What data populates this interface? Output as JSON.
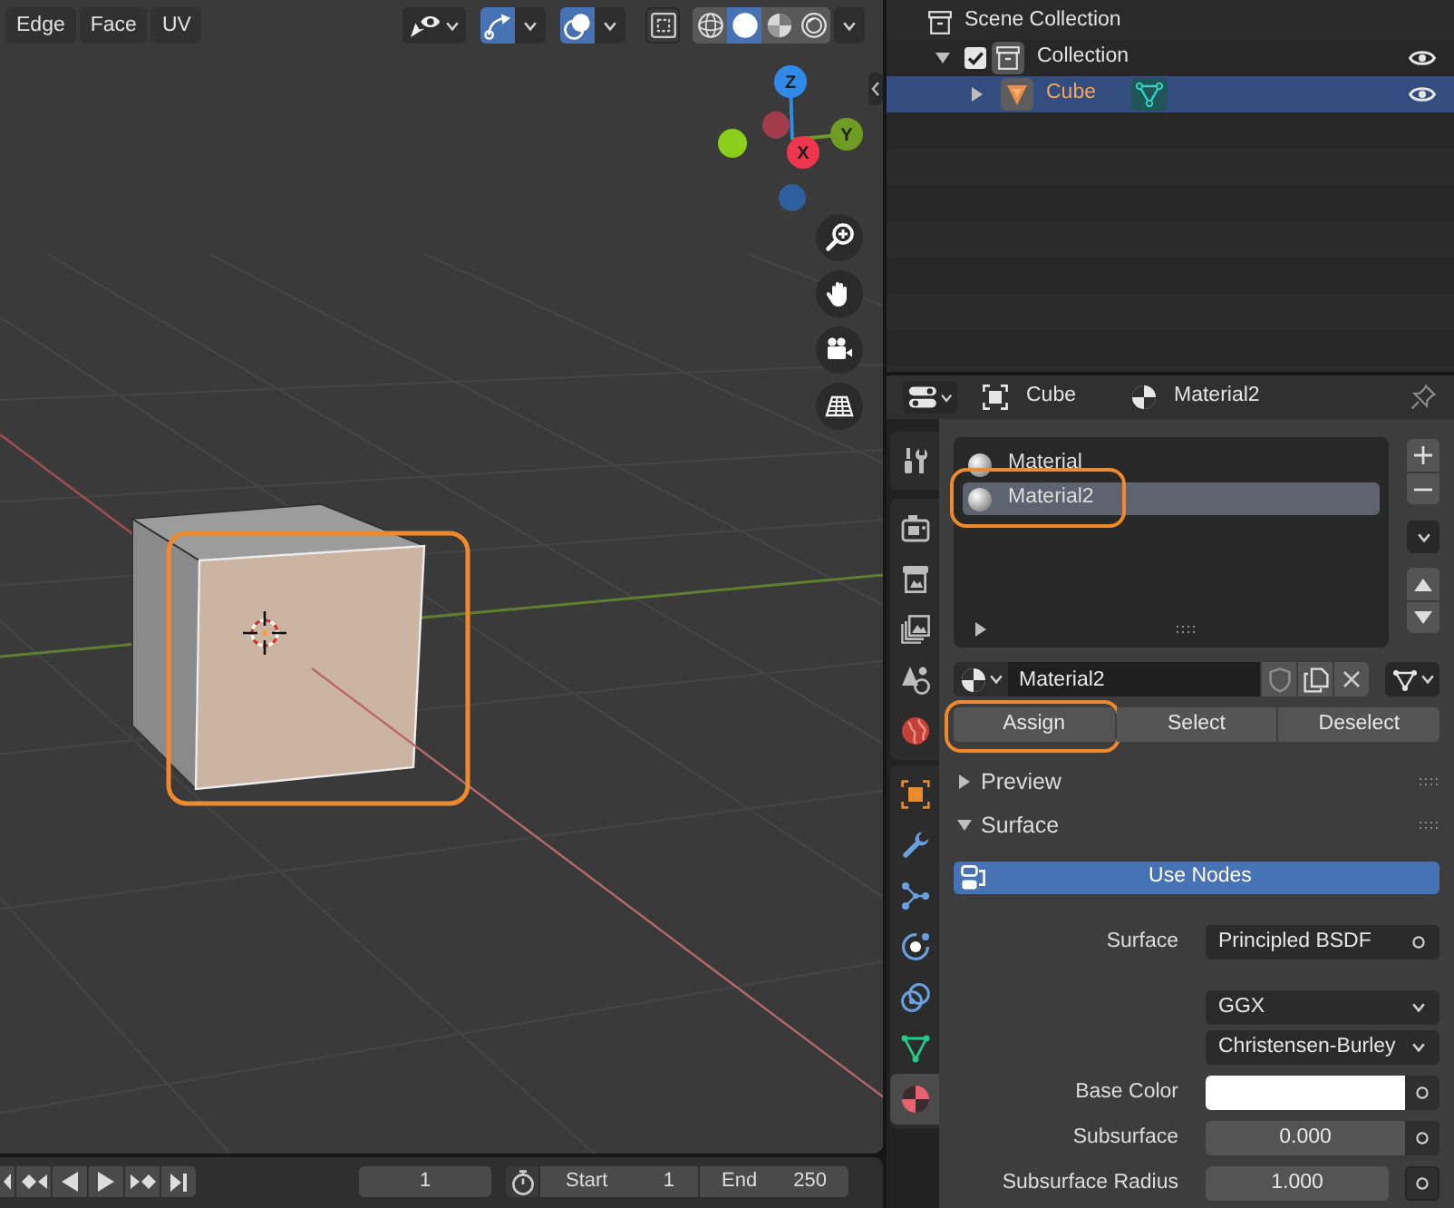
{
  "viewport": {
    "menus": [
      {
        "label": "Edge"
      },
      {
        "label": "Face"
      },
      {
        "label": "UV"
      }
    ],
    "toggles": [
      {
        "kind": "gizmo",
        "on": true
      },
      {
        "kind": "overlay",
        "on": true
      },
      {
        "kind": "xray",
        "on": false
      }
    ],
    "shading": [
      {
        "kind": "wireframe",
        "selected": false
      },
      {
        "kind": "solid",
        "selected": true
      },
      {
        "kind": "material",
        "selected": false
      },
      {
        "kind": "rendered",
        "selected": false
      }
    ],
    "gizmo_axes": [
      {
        "kind": "x_neg",
        "color": "#a33b4c"
      },
      {
        "kind": "y_neg",
        "color": "#8bcf1d"
      },
      {
        "kind": "z_neg",
        "color": "#2d5f9e"
      },
      {
        "kind": "z_pos",
        "label": "Z",
        "color": "#2f8ae8"
      },
      {
        "kind": "y_pos",
        "label": "Y",
        "color": "#6f9c23"
      },
      {
        "kind": "x_pos",
        "label": "X",
        "color": "#f0364f"
      }
    ],
    "cube": {
      "face_selected": true,
      "highlighted": true
    }
  },
  "outliner": {
    "items": [
      {
        "kind": "scene_collection",
        "label": "Scene Collection",
        "selected": false,
        "children": [
          {
            "kind": "collection",
            "label": "Collection",
            "selected": false,
            "expanded": true,
            "checked": true,
            "children": [
              {
                "kind": "mesh_object",
                "label": "Cube",
                "selected": true,
                "expanded": false
              }
            ]
          }
        ]
      }
    ]
  },
  "properties": {
    "context": [
      {
        "kind": "object",
        "label": "Cube"
      },
      {
        "kind": "material",
        "label": "Material2"
      }
    ],
    "tab_groups": [
      {
        "tabs": [
          {
            "kind": "tool",
            "selected": false
          }
        ]
      },
      {
        "tabs": [
          {
            "kind": "render",
            "selected": false
          },
          {
            "kind": "output",
            "selected": false
          },
          {
            "kind": "view_layer",
            "selected": false
          },
          {
            "kind": "scene",
            "selected": false
          },
          {
            "kind": "world",
            "selected": false
          }
        ]
      },
      {
        "tabs": [
          {
            "kind": "object",
            "selected": false
          },
          {
            "kind": "modifiers",
            "selected": false
          },
          {
            "kind": "particles",
            "selected": false
          },
          {
            "kind": "physics",
            "selected": false
          },
          {
            "kind": "constraints",
            "selected": false
          },
          {
            "kind": "data",
            "selected": false
          },
          {
            "kind": "material",
            "selected": true
          }
        ]
      }
    ],
    "material_slots": [
      {
        "label": "Material",
        "selected": false,
        "highlighted": false
      },
      {
        "label": "Material2",
        "selected": true,
        "highlighted": true
      }
    ],
    "material_name": "Material2",
    "slot_actions": [
      {
        "label": "Assign",
        "highlighted": true
      },
      {
        "label": "Select",
        "highlighted": false
      },
      {
        "label": "Deselect",
        "highlighted": false
      }
    ],
    "panels": [
      {
        "label": "Preview",
        "expanded": false
      },
      {
        "label": "Surface",
        "expanded": true
      }
    ],
    "use_nodes": {
      "label": "Use Nodes",
      "on": true
    },
    "fields": [
      {
        "kind": "node",
        "label": "Surface",
        "value": "Principled BSDF"
      },
      {
        "kind": "dropdown",
        "value": "GGX"
      },
      {
        "kind": "dropdown",
        "value": "Christensen-Burley"
      },
      {
        "kind": "color",
        "label": "Base Color",
        "color": "#ffffff"
      },
      {
        "kind": "number",
        "label": "Subsurface",
        "value": "0.000"
      },
      {
        "kind": "vector",
        "label": "Subsurface Radius",
        "value": "1.000"
      }
    ]
  },
  "timeline": {
    "frame": "1",
    "start": {
      "label": "Start",
      "value": "1"
    },
    "end": {
      "label": "End",
      "value": "250"
    }
  }
}
